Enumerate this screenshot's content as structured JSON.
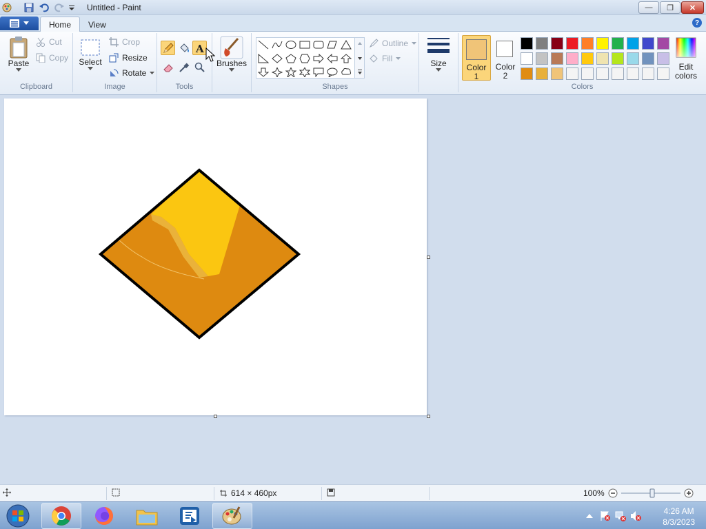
{
  "window": {
    "title": "Untitled - Paint",
    "controls": {
      "minimize": "—",
      "maximize": "❐",
      "close": "✕"
    }
  },
  "tabs": {
    "home": "Home",
    "view": "View"
  },
  "ribbon": {
    "clipboard": {
      "label": "Clipboard",
      "paste": "Paste",
      "cut": "Cut",
      "copy": "Copy"
    },
    "image": {
      "label": "Image",
      "select": "Select",
      "crop": "Crop",
      "resize": "Resize",
      "rotate": "Rotate"
    },
    "tools": {
      "label": "Tools"
    },
    "brushes": {
      "label": "Brushes"
    },
    "shapes": {
      "label": "Shapes",
      "outline": "Outline",
      "fill": "Fill"
    },
    "size": {
      "label": "Size"
    },
    "colors": {
      "label": "Colors",
      "color1": "Color",
      "color1_num": "1",
      "color2": "Color",
      "color2_num": "2",
      "edit": "Edit",
      "edit2": "colors",
      "color1_value": "#f0c478",
      "color2_value": "#ffffff",
      "palette_row1": [
        "#000000",
        "#7f7f7f",
        "#880015",
        "#ed1c24",
        "#ff7f27",
        "#fff200",
        "#22b14c",
        "#00a2e8",
        "#3f48cc",
        "#a349a4"
      ],
      "palette_row2": [
        "#ffffff",
        "#c3c3c3",
        "#b97a57",
        "#ffaec9",
        "#ffc90e",
        "#efe4b0",
        "#b5e61d",
        "#99d9ea",
        "#7092be",
        "#c8bfe7"
      ],
      "palette_row3": [
        "#e08c12",
        "#e8b03a",
        "#f0c478",
        "#f4f4f4",
        "#f4f4f4",
        "#f4f4f4",
        "#f4f4f4",
        "#f4f4f4",
        "#f4f4f4",
        "#f4f4f4"
      ]
    }
  },
  "status": {
    "dimensions": "614 × 460px",
    "zoom": "100%",
    "zoom_level": 100
  },
  "taskbar": {
    "time": "4:26 AM",
    "date": "8/3/2023"
  }
}
